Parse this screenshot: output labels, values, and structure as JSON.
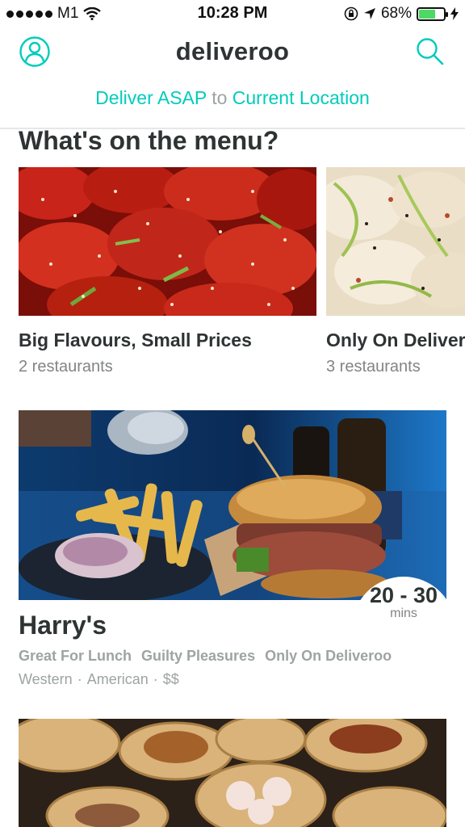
{
  "status_bar": {
    "carrier": "M1",
    "time": "10:28 PM",
    "battery_text": "68%",
    "battery_level": 0.68,
    "battery_color": "#4cd964"
  },
  "header": {
    "brand": "deliveroo",
    "account_icon": "account-icon",
    "search_icon": "search-icon",
    "accent_color": "#00ccbc"
  },
  "delivery": {
    "when": "Deliver ASAP",
    "connector": "to",
    "where": "Current Location"
  },
  "menu_section": {
    "title": "What's on the menu?",
    "cards": [
      {
        "title": "Big Flavours, Small Prices",
        "subtitle": "2 restaurants"
      },
      {
        "title": "Only On Deliveroo",
        "subtitle": "3 restaurants"
      }
    ]
  },
  "restaurant": {
    "name": "Harry's",
    "eta_value": "20 - 30",
    "eta_unit": "mins",
    "tags": [
      "Great For Lunch",
      "Guilty Pleasures",
      "Only On Deliveroo"
    ],
    "cuisine": [
      "Western",
      "American",
      "$$"
    ]
  }
}
